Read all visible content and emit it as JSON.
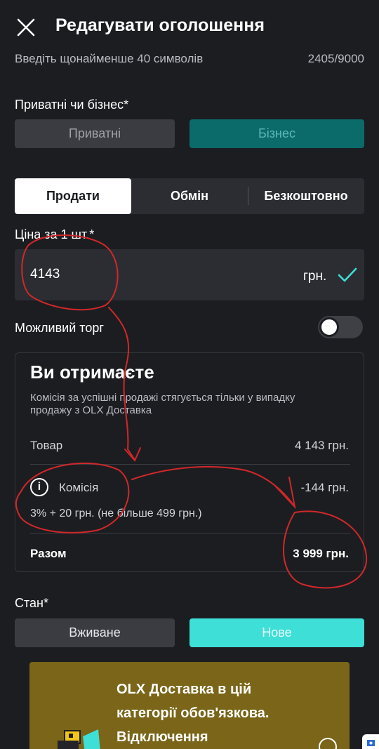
{
  "header": {
    "title": "Редагувати оголошення",
    "close_icon": "close-icon"
  },
  "description": {
    "hint": "Введіть щонайменше 40 символів",
    "counter": "2405/9000"
  },
  "seller_type": {
    "label": "Приватні чи бізнес*",
    "options": [
      "Приватні",
      "Бізнес"
    ],
    "selected": "Бізнес"
  },
  "deal_type": {
    "tabs": [
      "Продати",
      "Обмін",
      "Безкоштовно"
    ],
    "selected": "Продати"
  },
  "price": {
    "label": "Ціна за 1 шт.*",
    "value": "4143",
    "currency": "грн."
  },
  "negotiable": {
    "label": "Можливий торг",
    "enabled": false
  },
  "receive": {
    "title": "Ви отримаєте",
    "note": "Комісія за успішні продажі стягується тільки у випадку продажу з OLX Доставка",
    "item_label": "Товар",
    "item_value": "4 143 грн.",
    "fee_label": "Комісія",
    "fee_value": "-144 грн.",
    "fee_detail": "3% + 20 грн. (не більше 499 грн.)",
    "total_label": "Разом",
    "total_value": "3 999 грн."
  },
  "condition": {
    "label": "Стан*",
    "options": [
      "Вживане",
      "Нове"
    ],
    "selected": "Нове"
  },
  "banner": {
    "text": "OLX Доставка в цій категорії обов'язкова. Відключення"
  },
  "colors": {
    "background": "#1c1d21",
    "accent_teal": "#0b6a6a",
    "accent_cyan": "#3ddfd6",
    "annotation_red": "#d0282a",
    "banner": "#7a6518"
  }
}
